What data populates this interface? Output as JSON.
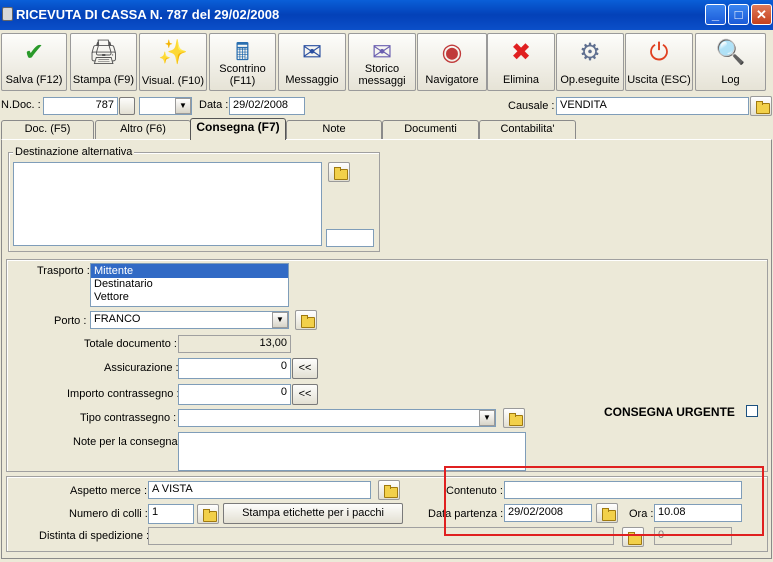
{
  "window": {
    "title": "RICEVUTA DI CASSA N.  787  del 29/02/2008",
    "min": "_",
    "max": "□",
    "close": "✕"
  },
  "toolbar": [
    {
      "label": "Salva (F12)",
      "icon": "✔",
      "color": "#2a9a2a"
    },
    {
      "label": "Stampa (F9)",
      "icon": "🖨",
      "color": "#555"
    },
    {
      "label": "Visual. (F10)",
      "icon": "✨",
      "color": "#c8a020"
    },
    {
      "label": "Scontrino (F11)",
      "icon": "🖩",
      "color": "#2a6fb0"
    },
    {
      "label": "Messaggio",
      "icon": "✉",
      "color": "#2a4fa0"
    },
    {
      "label": "Storico messaggi",
      "icon": "✉",
      "color": "#6a5fb0"
    },
    {
      "label": "Navigatore",
      "icon": "◉",
      "color": "#c03a3a"
    },
    {
      "label": "Elimina",
      "icon": "✖",
      "color": "#e02020"
    },
    {
      "label": "Op.eseguite",
      "icon": "⚙",
      "color": "#607090"
    },
    {
      "label": "Uscita (ESC)",
      "icon": "⏻",
      "color": "#e04020"
    },
    {
      "label": "Log",
      "icon": "🔍",
      "color": "#2a6fb0"
    }
  ],
  "header": {
    "ndoc_label": "N.Doc. :",
    "ndoc_value": "787",
    "data_label": "Data :",
    "data_value": "29/02/2008",
    "causale_label": "Causale :",
    "causale_value": "VENDITA"
  },
  "tabs": [
    "Doc. (F5)",
    "Altro (F6)",
    "Consegna (F7)",
    "Note",
    "Documenti",
    "Contabilita'"
  ],
  "destinazione": {
    "label": "Destinazione alternativa",
    "text": "",
    "code": ""
  },
  "trasporto": {
    "label": "Trasporto :",
    "options": [
      "Mittente",
      "Destinatario",
      "Vettore"
    ],
    "selected": 0
  },
  "porto": {
    "label": "Porto :",
    "value": "FRANCO"
  },
  "totale": {
    "label": "Totale documento :",
    "value": "13,00"
  },
  "assicurazione": {
    "label": "Assicurazione :",
    "value": "0",
    "btn": "<<"
  },
  "importo": {
    "label": "Importo contrassegno :",
    "value": "0",
    "btn": "<<"
  },
  "tipo": {
    "label": "Tipo contrassegno :",
    "value": ""
  },
  "note": {
    "label": "Note per la consegna",
    "value": ""
  },
  "urgente": {
    "label": "CONSEGNA URGENTE"
  },
  "aspetto": {
    "label": "Aspetto merce :",
    "value": "A VISTA"
  },
  "colli": {
    "label": "Numero di colli :",
    "value": "1"
  },
  "stampa_btn": "Stampa etichette per i pacchi",
  "distinta": {
    "label": "Distinta di spedizione :",
    "value": "",
    "code": "0"
  },
  "contenuto": {
    "label": "Contenuto :",
    "value": ""
  },
  "partenza": {
    "label": "Data partenza :",
    "value": "29/02/2008"
  },
  "ora": {
    "label": "Ora :",
    "value": "10.08"
  },
  "highlight_color": "#e02020"
}
